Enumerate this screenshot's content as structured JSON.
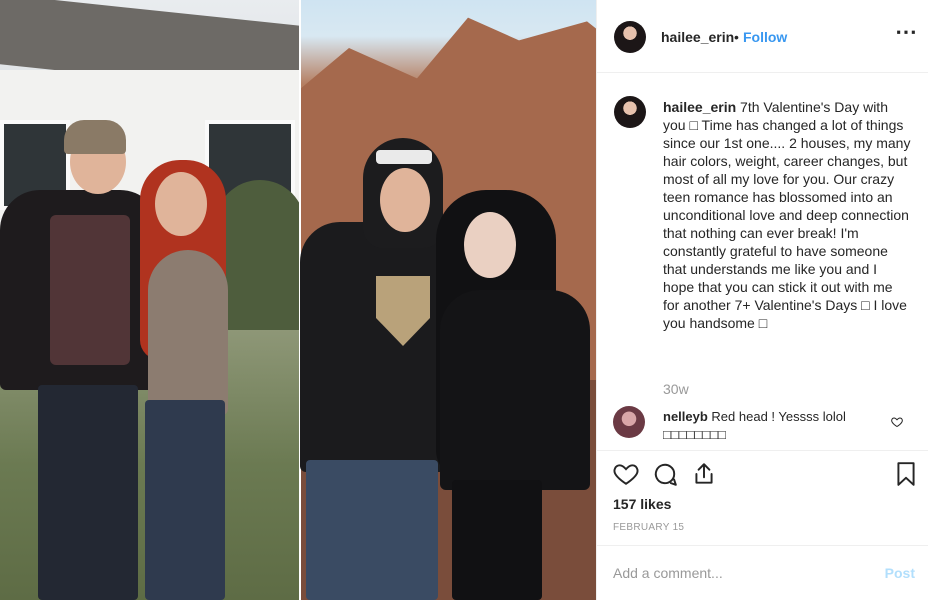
{
  "post": {
    "username": "hailee_erin",
    "follow_separator": "•",
    "follow_label": "Follow",
    "more_icon": "⋯"
  },
  "caption": {
    "username": "hailee_erin",
    "text": "7th Valentine's Day with you □ Time has changed a lot of things since our 1st one.... 2 houses, my many hair colors, weight, career changes, but most of all my love for you. Our crazy teen romance has blossomed into an unconditional love and deep connection that nothing can ever break! I'm constantly grateful to have someone that understands me like you and I hope that you can stick it out with me for another 7+ Valentine's Days □ I love you handsome □",
    "time_ago": "30w"
  },
  "comment": {
    "username": "nelleyb",
    "text": "Red head ! Yessss lolol □□□□□□□□"
  },
  "actions": {
    "likes": "157 likes",
    "date": "FEBRUARY 15"
  },
  "add_comment": {
    "placeholder": "Add a comment...",
    "post_label": "Post"
  },
  "colors": {
    "link_blue": "#3897f0",
    "post_disabled": "#b2dffc",
    "muted_text": "#999999",
    "border": "#efefef"
  },
  "icons": [
    "more-options-icon",
    "heart-icon",
    "comment-icon",
    "share-icon",
    "bookmark-icon",
    "comment-like-icon"
  ]
}
